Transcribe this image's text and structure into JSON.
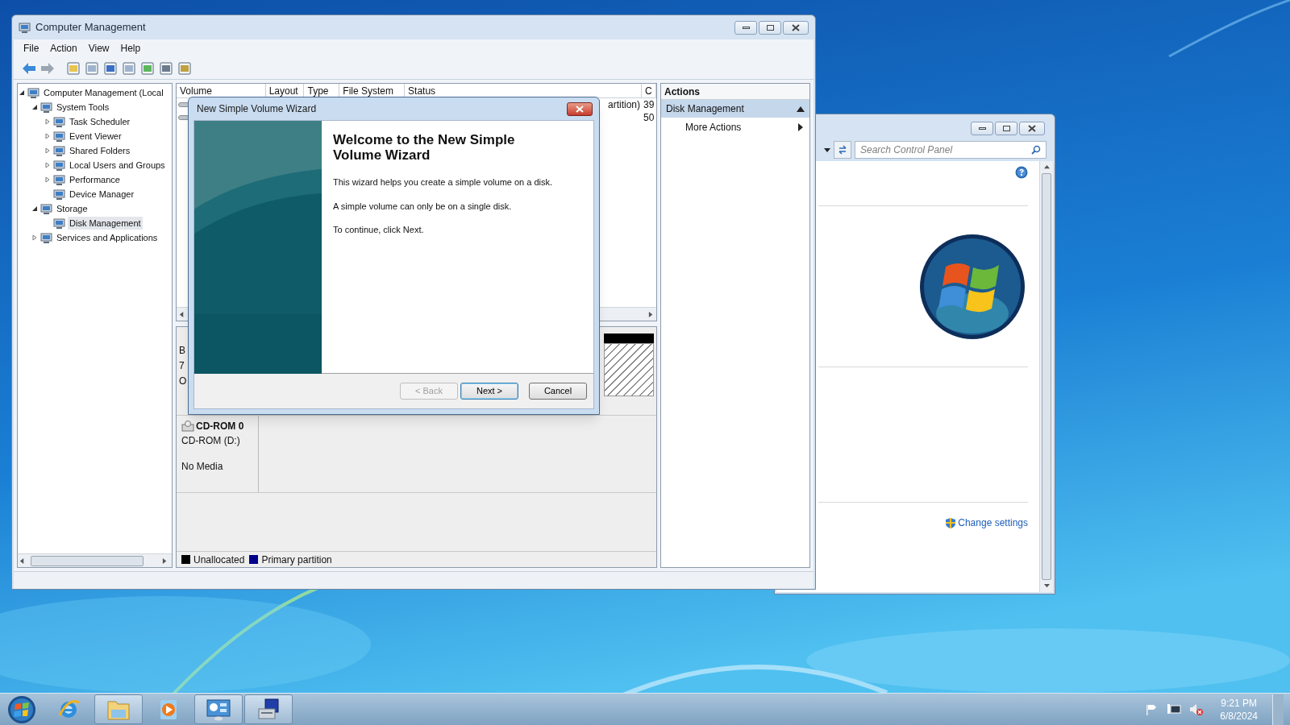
{
  "computer_management": {
    "title": "Computer Management",
    "menu": [
      "File",
      "Action",
      "View",
      "Help"
    ],
    "tree": [
      {
        "label": "Computer Management (Local",
        "expanded": true,
        "selected": false,
        "children": [
          {
            "label": "System Tools",
            "expanded": true,
            "selected": false,
            "children": [
              {
                "label": "Task Scheduler",
                "expanded": false,
                "selected": false
              },
              {
                "label": "Event Viewer",
                "expanded": false,
                "selected": false
              },
              {
                "label": "Shared Folders",
                "expanded": false,
                "selected": false
              },
              {
                "label": "Local Users and Groups",
                "expanded": false,
                "selected": false
              },
              {
                "label": "Performance",
                "expanded": false,
                "selected": false
              },
              {
                "label": "Device Manager",
                "selected": false
              }
            ]
          },
          {
            "label": "Storage",
            "expanded": true,
            "selected": false,
            "children": [
              {
                "label": "Disk Management",
                "selected": true
              }
            ]
          },
          {
            "label": "Services and Applications",
            "expanded": false,
            "selected": false
          }
        ]
      }
    ],
    "volume_list": {
      "columns": [
        "Volume",
        "Layout",
        "Type",
        "File System",
        "Status",
        "C"
      ],
      "rows": [
        {
          "status": "artition)",
          "column_6": "39"
        },
        {
          "column_6": "50"
        }
      ]
    },
    "disk_0_fragments": [
      "B",
      "7",
      "O"
    ],
    "cdrom": {
      "name": "CD-ROM 0",
      "drive": "CD-ROM (D:)",
      "media": "No Media"
    },
    "legend": [
      {
        "label": "Unallocated",
        "color": "#000000"
      },
      {
        "label": "Primary partition",
        "color": "#00008b"
      }
    ],
    "actions": {
      "header": "Actions",
      "items": [
        {
          "label": "Disk Management",
          "kind": "section"
        },
        {
          "label": "More Actions",
          "kind": "submenu"
        }
      ]
    }
  },
  "wizard": {
    "title": "New Simple Volume Wizard",
    "heading": "Welcome to the New Simple Volume Wizard",
    "paragraphs": [
      "This wizard helps you create a simple volume on a disk.",
      "A simple volume can only be on a single disk.",
      "To continue, click Next."
    ],
    "buttons": [
      {
        "label": "< Back",
        "disabled": true,
        "selected": false
      },
      {
        "label": "Next >",
        "disabled": false,
        "selected": true
      },
      {
        "label": "Cancel",
        "disabled": false,
        "selected": false
      }
    ]
  },
  "control_panel": {
    "search_placeholder": "Search Control Panel",
    "link": "Change settings"
  },
  "taskbar": {
    "items": [
      {
        "kind": "ie",
        "open": false
      },
      {
        "kind": "explorer",
        "open": true
      },
      {
        "kind": "media",
        "open": false
      },
      {
        "kind": "control",
        "open": true
      },
      {
        "kind": "computer",
        "open": true
      }
    ],
    "time": "9:21 PM",
    "date": "6/8/2024"
  }
}
